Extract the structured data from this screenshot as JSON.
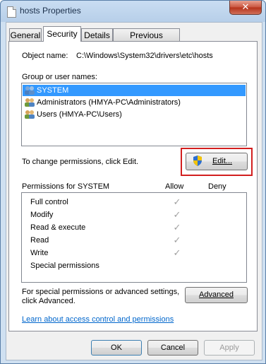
{
  "window": {
    "title": "hosts Properties",
    "close_glyph": "✕"
  },
  "tabs": [
    {
      "label": "General",
      "active": false
    },
    {
      "label": "Security",
      "active": true
    },
    {
      "label": "Details",
      "active": false
    },
    {
      "label": "Previous Versions",
      "active": false
    }
  ],
  "security": {
    "object_name_label": "Object name:",
    "object_name_value": "C:\\Windows\\System32\\drivers\\etc\\hosts",
    "group_label": "Group or user names:",
    "users": [
      {
        "name": "SYSTEM",
        "selected": true
      },
      {
        "name": "Administrators (HMYA-PC\\Administrators)",
        "selected": false
      },
      {
        "name": "Users (HMYA-PC\\Users)",
        "selected": false
      }
    ],
    "change_text": "To change permissions, click Edit.",
    "edit_button": "Edit...",
    "permissions_header": "Permissions for SYSTEM",
    "allow_header": "Allow",
    "deny_header": "Deny",
    "permissions": [
      {
        "name": "Full control",
        "allow": true,
        "deny": false
      },
      {
        "name": "Modify",
        "allow": true,
        "deny": false
      },
      {
        "name": "Read & execute",
        "allow": true,
        "deny": false
      },
      {
        "name": "Read",
        "allow": true,
        "deny": false
      },
      {
        "name": "Write",
        "allow": true,
        "deny": false
      },
      {
        "name": "Special permissions",
        "allow": false,
        "deny": false
      }
    ],
    "check_glyph": "✓",
    "advanced_text_line1": "For special permissions or advanced settings,",
    "advanced_text_line2": "click Advanced.",
    "advanced_button": "Advanced",
    "help_link": "Learn about access control and permissions"
  },
  "footer": {
    "ok": "OK",
    "cancel": "Cancel",
    "apply": "Apply"
  },
  "colors": {
    "highlight": "#d21f1f",
    "selection": "#3399ff",
    "link": "#0066cc"
  }
}
